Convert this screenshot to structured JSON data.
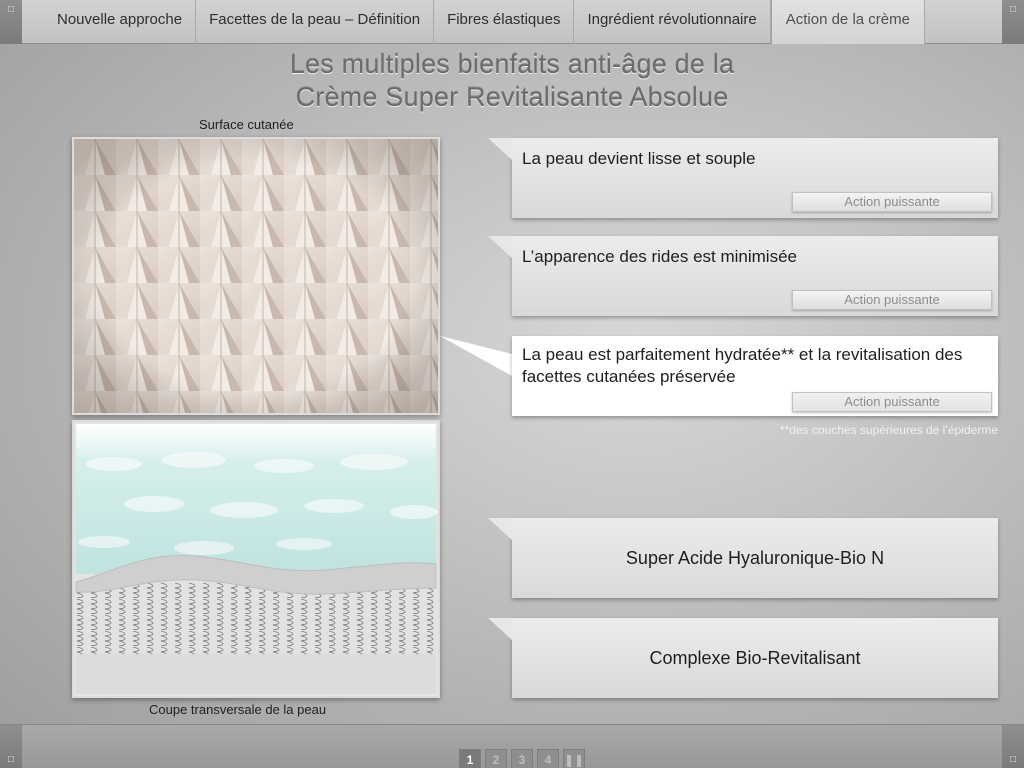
{
  "nav": {
    "tabs": [
      {
        "label": "Nouvelle approche"
      },
      {
        "label": "Facettes de la peau – Définition"
      },
      {
        "label": "Fibres élastiques"
      },
      {
        "label": "Ingrédient révolutionnaire"
      },
      {
        "label": "Action de la crème"
      }
    ],
    "active_tab": "Action de la crème",
    "corner_icon": "□"
  },
  "title": {
    "line1": "Les multiples bienfaits anti-âge de la",
    "line2": "Crème Super Revitalisante Absolue"
  },
  "images": {
    "surface_caption": "Surface cutanée",
    "section_caption": "Coupe transversale de la peau"
  },
  "benefits": [
    {
      "text": "La peau devient lisse et souple",
      "action": "Action puissante"
    },
    {
      "text": "L’apparence des rides est minimisée",
      "action": "Action puissante"
    },
    {
      "text": "La peau est parfaitement hydratée** et la revitalisation des facettes cutanées préservée",
      "action": "Action puissante"
    }
  ],
  "footnote": "**des couches supérieures de l’épiderme",
  "ingredients": [
    {
      "label": "Super Acide Hyaluronique-Bio N"
    },
    {
      "label": "Complexe Bio-Revitalisant"
    }
  ],
  "pager": {
    "pages": [
      "1",
      "2",
      "3",
      "4"
    ],
    "current": "1",
    "pause_icon": "❚❚"
  },
  "colors": {
    "background": "#b8b8b8",
    "card": "#e0e0e0",
    "card_highlight": "#ffffff",
    "title": "#6c6c6c"
  }
}
